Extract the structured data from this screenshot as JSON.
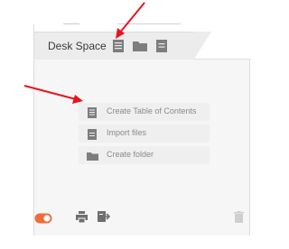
{
  "tab": {
    "title": "Desk Space"
  },
  "menu": {
    "items": [
      {
        "label": "Create Table of Contents",
        "icon": "document-list-icon"
      },
      {
        "label": "Import files",
        "icon": "document-icon"
      },
      {
        "label": "Create folder",
        "icon": "folder-icon"
      }
    ]
  },
  "footer": {
    "icons": [
      "toggle-icon",
      "print-icon",
      "export-icon",
      "trash-icon"
    ]
  },
  "colors": {
    "toggle": "#f26b3a",
    "annotation_arrow": "#e8141c",
    "icon": "#7d7d7d",
    "window_control_green": "#7ccf6e",
    "window_control_purple": "#a67cd8"
  }
}
